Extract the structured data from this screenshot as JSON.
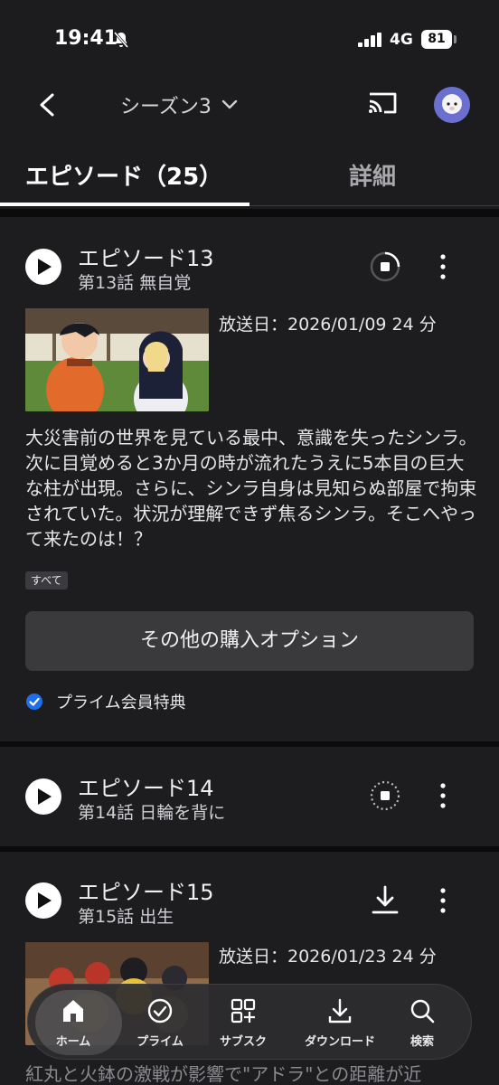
{
  "status_bar": {
    "time": "19:41",
    "network": "4G",
    "battery": "81"
  },
  "nav": {
    "season": "シーズン3"
  },
  "tabs": {
    "episodes": "エピソード（25）",
    "details": "詳細"
  },
  "episodes": [
    {
      "title": "エピソード13",
      "subtitle": "第13話 無自覚",
      "air_date": "放送日：2026/01/09 24 分",
      "synopsis": "大災害前の世界を見ている最中、意識を失ったシンラ。次に目覚めると3か月の時が流れたうえに5本目の巨大な柱が出現。さらに、シンラ自身は見知らぬ部屋で拘束されていた。状況が理解できず焦るシンラ。そこへやって来たのは！？",
      "tag": "すべて",
      "buy_label": "その他の購入オプション",
      "prime_label": "プライム会員特典"
    },
    {
      "title": "エピソード14",
      "subtitle": "第14話 日輪を背に"
    },
    {
      "title": "エピソード15",
      "subtitle": "第15話 出生",
      "air_date": "放送日：2026/01/23 24 分",
      "synopsis": "紅丸と火鉢の激戦が影響で\"アドラ\"との距離が近"
    }
  ],
  "bottom_nav": [
    {
      "label": "ホーム",
      "icon": "home-icon"
    },
    {
      "label": "プライム",
      "icon": "prime-check-icon"
    },
    {
      "label": "サブスク",
      "icon": "grid-plus-icon"
    },
    {
      "label": "ダウンロード",
      "icon": "download-icon"
    },
    {
      "label": "検索",
      "icon": "search-icon"
    }
  ],
  "colors": {
    "accent_blue": "#1f6feb",
    "card_bg": "#1d1d20",
    "page_bg": "#0b0b0c"
  }
}
